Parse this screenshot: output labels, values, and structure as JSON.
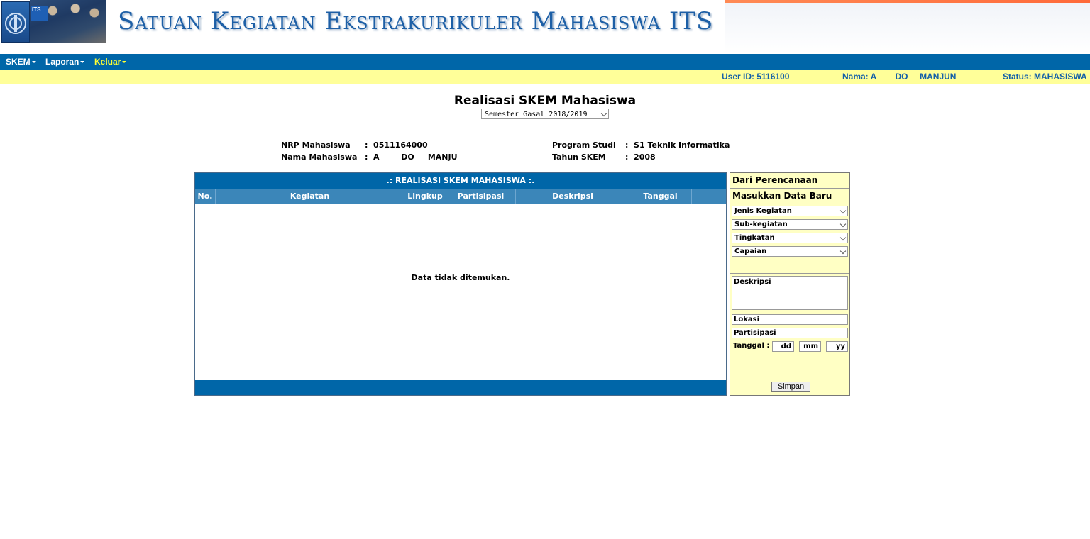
{
  "header": {
    "title": "Satuan Kegiatan Ekstrakurikuler Mahasiswa ITS",
    "logo_text": "ITS"
  },
  "nav": {
    "items": [
      {
        "label": "SKEM"
      },
      {
        "label": "Laporan"
      },
      {
        "label": "Keluar"
      }
    ]
  },
  "userbar": {
    "user_id": "User ID: 5116100",
    "nama": "Nama: A        DO     MANJUN",
    "status": "Status: MAHASISWA"
  },
  "page": {
    "title": "Realisasi SKEM Mahasiswa",
    "semester": "Semester Gasal 2018/2019"
  },
  "student": {
    "nrp_label": "NRP Mahasiswa",
    "nrp_value": ":  0511164000",
    "nama_label": "Nama Mahasiswa",
    "nama_value": ":  A        DO     MANJU",
    "prodi_label": "Program Studi",
    "prodi_value": ":  S1 Teknik Informatika",
    "tahun_label": "Tahun SKEM",
    "tahun_value": ":  2008"
  },
  "table": {
    "title": ".: REALISASI SKEM MAHASISWA :.",
    "columns": [
      "No.",
      "Kegiatan",
      "Lingkup",
      "Partisipasi",
      "Deskripsi",
      "Tanggal"
    ],
    "empty_message": "Data tidak ditemukan."
  },
  "side": {
    "from_plan": "Dari Perencanaan",
    "new_data": "Masukkan Data Baru",
    "selects": [
      "Jenis Kegiatan",
      "Sub-kegiatan",
      "Tingkatan",
      "Capaian"
    ],
    "deskripsi_placeholder": "Deskripsi",
    "lokasi_placeholder": "Lokasi",
    "partisipasi_placeholder": "Partisipasi",
    "tanggal_label": "Tanggal :",
    "dd": "dd",
    "mm": "mm",
    "yy": "yy",
    "save_label": "Simpan"
  },
  "colors": {
    "nav_bg": "#0066a8",
    "userbar_bg": "#ffff99",
    "active_nav": "#ffff33",
    "side_bg": "#ffffc4"
  }
}
